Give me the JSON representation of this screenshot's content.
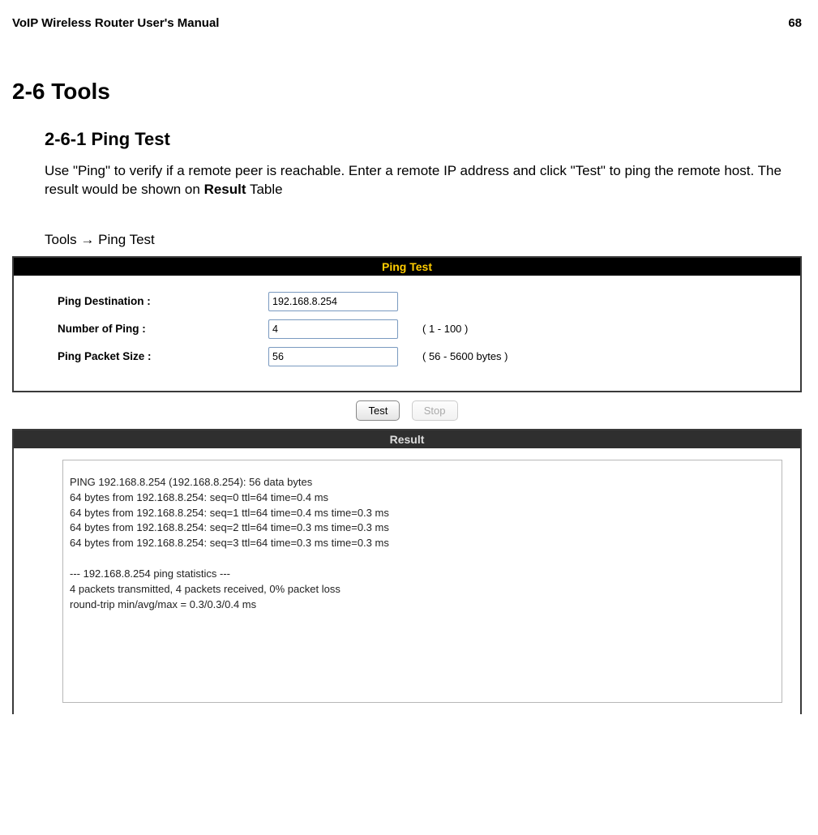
{
  "header": {
    "title": "VoIP Wireless Router User's Manual",
    "page_number": "68"
  },
  "section": {
    "title": "2-6 Tools",
    "subtitle": "2-6-1 Ping Test",
    "description_part1": "Use \"Ping\" to verify if a remote peer is reachable. Enter a remote IP address and click \"Test\" to ping the remote host. The result would be shown on ",
    "description_bold": "Result",
    "description_part2": " Table",
    "breadcrumb": "Tools  →  Ping Test"
  },
  "ping_panel": {
    "title": "Ping Test",
    "rows": {
      "destination": {
        "label": "Ping Destination :",
        "value": "192.168.8.254",
        "hint": ""
      },
      "number": {
        "label": "Number of Ping :",
        "value": "4",
        "hint": "( 1 - 100 )"
      },
      "size": {
        "label": "Ping Packet Size :",
        "value": "56",
        "hint": "( 56 - 5600 bytes )"
      }
    }
  },
  "buttons": {
    "test": "Test",
    "stop": "Stop"
  },
  "result_panel": {
    "title": "Result",
    "output": "PING 192.168.8.254 (192.168.8.254): 56 data bytes\n64 bytes from 192.168.8.254: seq=0 ttl=64 time=0.4 ms\n64 bytes from 192.168.8.254: seq=1 ttl=64 time=0.4 ms time=0.3 ms\n64 bytes from 192.168.8.254: seq=2 ttl=64 time=0.3 ms time=0.3 ms\n64 bytes from 192.168.8.254: seq=3 ttl=64 time=0.3 ms time=0.3 ms\n\n--- 192.168.8.254 ping statistics ---\n4 packets transmitted, 4 packets received, 0% packet loss\nround-trip min/avg/max = 0.3/0.3/0.4 ms"
  }
}
